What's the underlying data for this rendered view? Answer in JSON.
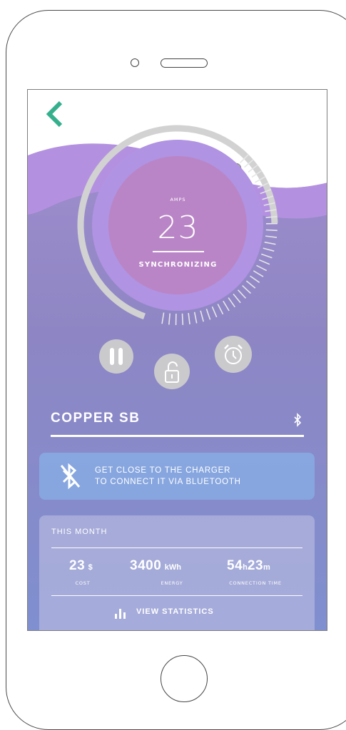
{
  "colors": {
    "accent_back": "#35b08d",
    "dial_inner": "#b985c6",
    "dial_ring": "#b093e2",
    "arc_gray": "#d2d2d2"
  },
  "icons": {
    "back": "chevron-left-icon",
    "pause": "pause-icon",
    "lock": "unlocked-padlock-icon",
    "alarm": "alarm-clock-icon",
    "bluetooth_small": "bluetooth-icon",
    "bluetooth_off": "bluetooth-disabled-icon",
    "stats": "bar-chart-icon"
  },
  "dial": {
    "label": "AMPS",
    "value": "23",
    "status": "SYNCHRONIZING"
  },
  "device": {
    "name": "COPPER SB"
  },
  "bluetooth_card": {
    "line1": "GET CLOSE TO THE CHARGER",
    "line2": "TO CONNECT IT VIA BLUETOOTH"
  },
  "stats": {
    "title": "THIS MONTH",
    "cost_value": "23",
    "cost_unit": "$",
    "cost_label": "COST",
    "energy_value": "3400",
    "energy_unit": "kWh",
    "energy_label": "ENERGY",
    "time_hours": "54",
    "time_h_unit": "h",
    "time_minutes": "23",
    "time_m_unit": "m",
    "time_label": "CONNECTION TIME",
    "view_label": "VIEW STATISTICS"
  }
}
